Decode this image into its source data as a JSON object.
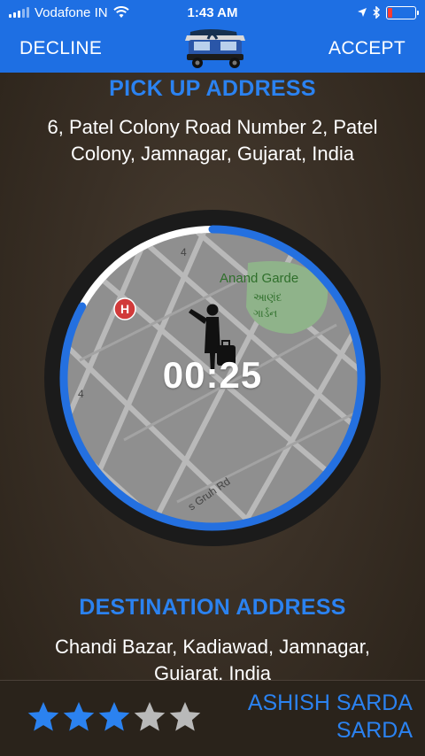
{
  "status_bar": {
    "carrier": "Vodafone IN",
    "time": "1:43 AM"
  },
  "header": {
    "decline_label": "DECLINE",
    "accept_label": "ACCEPT",
    "logo_icon": "auto-rickshaw-icon"
  },
  "pickup": {
    "title": "PICK UP ADDRESS",
    "address": "6, Patel Colony Road Number 2, Patel Colony, Jamnagar, Gujarat, India"
  },
  "timer": {
    "value": "00:25",
    "progress_fraction": 0.83,
    "map_labels": {
      "park_name": "Anand Garde",
      "park_name_local_1": "આણંદ",
      "park_name_local_2": "ગાર્ડન",
      "road_name": "s Gruh Rd",
      "road_number_a": "4",
      "road_number_b": "4",
      "hospital_marker": "H"
    }
  },
  "destination": {
    "title": "DESTINATION ADDRESS",
    "address": "Chandi Bazar, Kadiawad, Jamnagar, Gujarat, India"
  },
  "rider": {
    "name": "ASHISH SARDA SARDA",
    "rating": 3,
    "rating_max": 5
  },
  "colors": {
    "primary": "#1e6fe3",
    "accent": "#2b82f0",
    "star_active": "#2b82f0",
    "star_inactive": "#b9b9b9",
    "battery_low": "#ff3b30"
  }
}
